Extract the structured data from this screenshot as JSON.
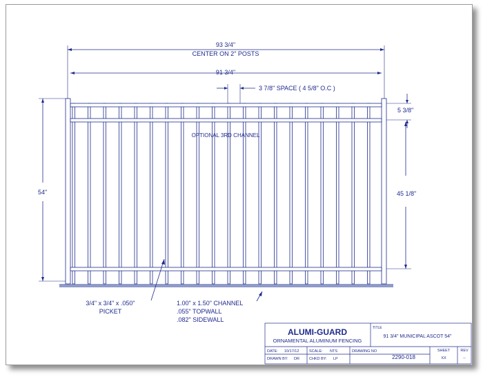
{
  "dimensions": {
    "overall_width": "93 3/4\"",
    "overall_note": "CENTER ON 2\" POSTS",
    "panel_width": "91 3/4\"",
    "picket_space": "3 7/8\" SPACE ( 4 5/8\" O.C )",
    "top_gap": "5 3/8\"",
    "height": "54\"",
    "picket_length": "45 1/8\""
  },
  "notes": {
    "third_channel": "OPTIONAL 3RD CHANNEL",
    "picket_size": "3/4\" x 3/4\" x .050\"",
    "picket_label": "PICKET",
    "channel_size": "1.00\" x 1.50\" CHANNEL",
    "topwall": ".055\" TOPWALL",
    "sidewall": ".082\" SIDEWALL"
  },
  "title_block": {
    "company": "ALUMI-GUARD",
    "subtitle": "ORNAMENTAL ALUMINUM FENCING",
    "title_label": "TITLE",
    "title": "91 3/4\" MUNICIPAL ASCOT 54\"",
    "date_label": "DATE:",
    "date": "10/17/12",
    "scale_label": "SCALE:",
    "scale": "NTS",
    "drawn_label": "DRAWN BY:",
    "drawn": "DR",
    "checked_label": "CHKD BY:",
    "checked": "LP",
    "drawing_no_label": "DRAWING NO",
    "drawing_no": "2290-018",
    "sheet_label": "SHEET",
    "sheet": "XX",
    "rev_label": "REV",
    "rev": "--"
  },
  "colors": {
    "line": "#1f2a8c",
    "ground": "#8e9ac8"
  }
}
